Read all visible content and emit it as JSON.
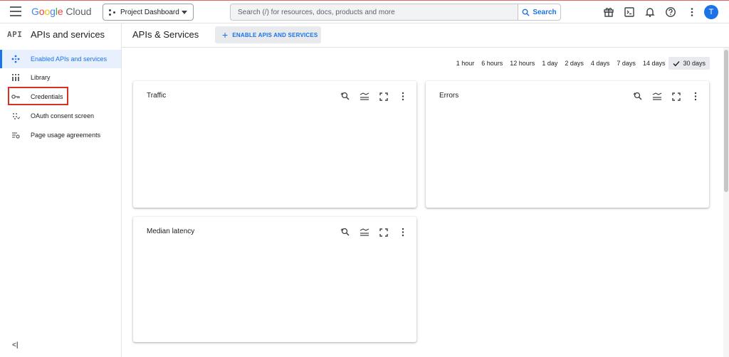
{
  "brand": {
    "google": "Google",
    "cloud": "Cloud"
  },
  "project": {
    "label": "Project Dashboard"
  },
  "search": {
    "placeholder": "Search (/) for resources, docs, products and more",
    "button_label": "Search"
  },
  "user": {
    "initial": "T"
  },
  "sidebar": {
    "api_mark": "API",
    "title": "APIs and services",
    "items": [
      {
        "label": "Enabled APIs and services",
        "icon": "diamond-arrows-icon",
        "active": true
      },
      {
        "label": "Library",
        "icon": "library-icon",
        "active": false
      },
      {
        "label": "Credentials",
        "icon": "key-icon",
        "active": false
      },
      {
        "label": "OAuth consent screen",
        "icon": "consent-icon",
        "active": false
      },
      {
        "label": "Page usage agreements",
        "icon": "settings-list-icon",
        "active": false
      }
    ],
    "collapse_label": "<|"
  },
  "main": {
    "title": "APIs & Services",
    "enable_button": "ENABLE APIS AND SERVICES"
  },
  "time_range": {
    "options": [
      "1 hour",
      "6 hours",
      "12 hours",
      "1 day",
      "2 days",
      "4 days",
      "7 days",
      "14 days",
      "30 days"
    ],
    "selected": "30 days"
  },
  "cards": [
    {
      "title": "Traffic"
    },
    {
      "title": "Errors"
    },
    {
      "title": "Median latency"
    }
  ],
  "colors": {
    "accent": "#1a73e8",
    "highlight": "#d93025",
    "active_bg": "#e8f0fe"
  }
}
